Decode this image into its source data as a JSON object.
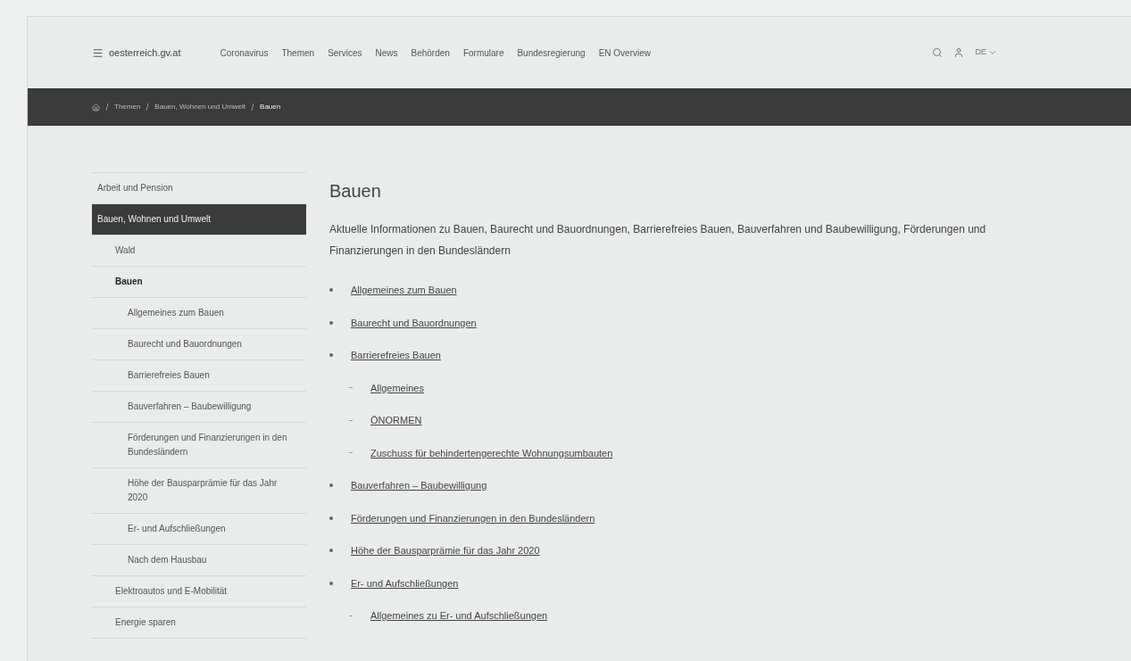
{
  "header": {
    "logo": "oesterreich.gv.at",
    "nav": [
      "Coronavirus",
      "Themen",
      "Services",
      "News",
      "Behörden",
      "Formulare",
      "Bundesregierung",
      "EN Overview"
    ],
    "language": "DE"
  },
  "breadcrumb": [
    "Themen",
    "Bauen, Wohnen und Umwelt",
    "Bauen"
  ],
  "sidebar": [
    {
      "label": "Arbeit und Pension",
      "selected": false
    },
    {
      "label": "Bauen, Wohnen und Umwelt",
      "selected": true,
      "children": [
        {
          "label": "Wald",
          "selected": false
        },
        {
          "label": "Bauen",
          "selected": true,
          "children": [
            {
              "label": "Allgemeines zum Bauen",
              "selected": false
            },
            {
              "label": "Baurecht und Bauordnungen",
              "selected": false
            },
            {
              "label": "Barrierefreies Bauen",
              "selected": false
            },
            {
              "label": "Bauverfahren – Baubewilligung",
              "selected": false
            },
            {
              "label": "Förderungen und Finanzierungen in den Bundesländern",
              "selected": false
            },
            {
              "label": "Höhe der Bausparprämie für das Jahr 2020",
              "selected": false
            },
            {
              "label": "Er- und Aufschließungen",
              "selected": false
            },
            {
              "label": "Nach dem Hausbau",
              "selected": false
            }
          ]
        },
        {
          "label": "Elektroautos und E-Mobilität",
          "selected": false
        },
        {
          "label": "Energie sparen",
          "selected": false
        }
      ]
    }
  ],
  "title": "Bauen",
  "intro": "Aktuelle Informationen zu Bauen, Baurecht und Bauordnungen, Barrierefreies Bauen, Bauverfahren und Baubewilligung, Förderungen und Finanzierungen in den Bundesländern",
  "links": [
    {
      "label": "Allgemeines zum Bauen"
    },
    {
      "label": "Baurecht und Bauordnungen"
    },
    {
      "label": "Barrierefreies Bauen",
      "children": [
        {
          "label": "Allgemeines"
        },
        {
          "label": "ÖNORMEN"
        },
        {
          "label": "Zuschuss für behindertengerechte Wohnungsumbauten"
        }
      ]
    },
    {
      "label": "Bauverfahren – Baubewilligung"
    },
    {
      "label": "Förderungen und Finanzierungen in den Bundesländern"
    },
    {
      "label": "Höhe der Bausparprämie für das Jahr 2020"
    },
    {
      "label": "Er- und Aufschließungen",
      "children": [
        {
          "label": "Allgemeines zu Er- und Aufschließungen"
        }
      ]
    }
  ]
}
